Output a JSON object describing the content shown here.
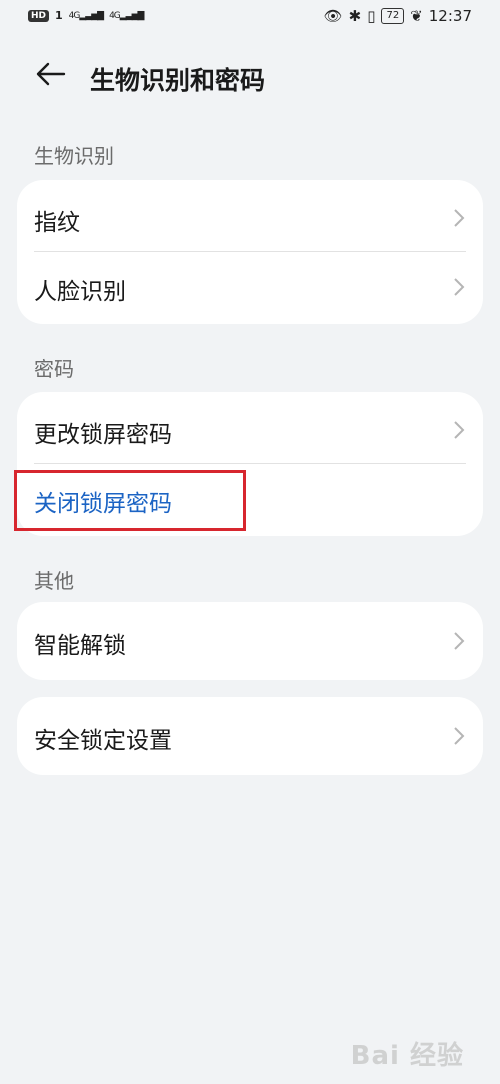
{
  "status_bar": {
    "hd_label": "HD",
    "sim1": "1",
    "net1": "4G",
    "net2": "4G",
    "battery": "72",
    "time": "12:37"
  },
  "header": {
    "title": "生物识别和密码"
  },
  "sections": {
    "biometrics": {
      "label": "生物识别",
      "items": [
        {
          "label": "指纹"
        },
        {
          "label": "人脸识别"
        }
      ]
    },
    "password": {
      "label": "密码",
      "items": [
        {
          "label": "更改锁屏密码"
        },
        {
          "label": "关闭锁屏密码"
        }
      ]
    },
    "other": {
      "label": "其他",
      "items": [
        {
          "label": "智能解锁"
        }
      ]
    },
    "security": {
      "items": [
        {
          "label": "安全锁定设置"
        }
      ]
    }
  },
  "watermark": "Bai 经验"
}
